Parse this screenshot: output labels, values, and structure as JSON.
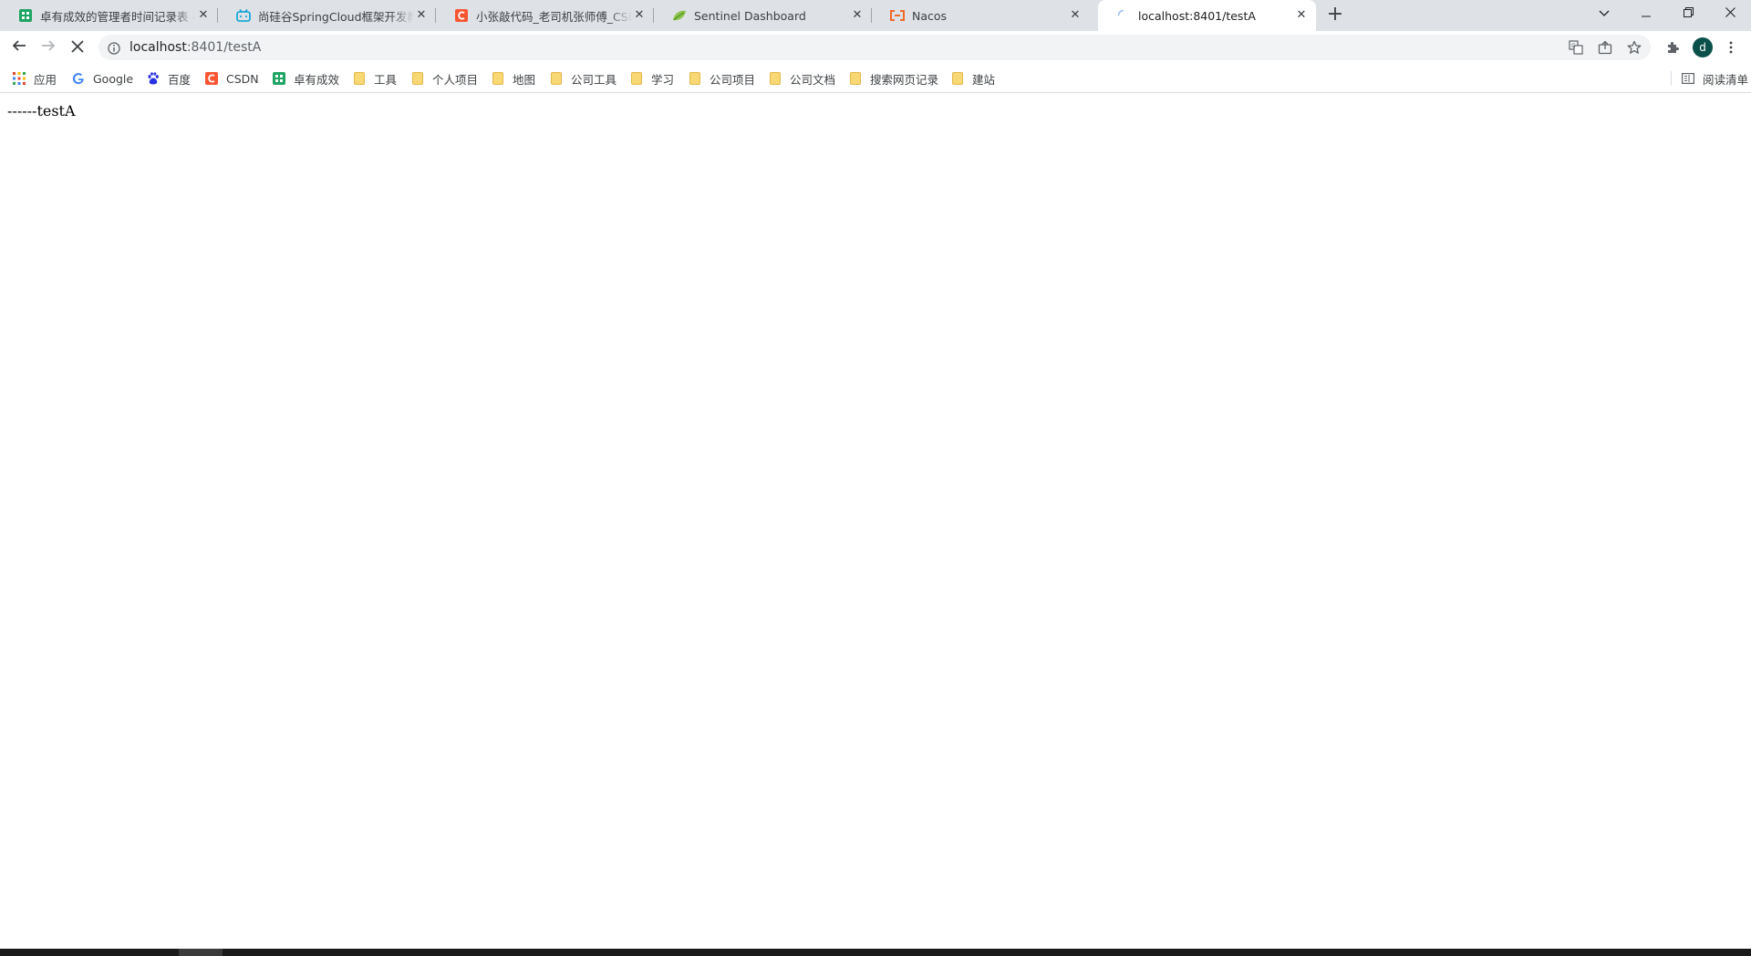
{
  "browser": {
    "tabs": [
      {
        "title": "卓有成效的管理者时间记录表 - 金山文档",
        "icon": "sheet-icon",
        "active": false
      },
      {
        "title": "尚硅谷SpringCloud框架开发教程",
        "icon": "bilibili-icon",
        "active": false
      },
      {
        "title": "小张敲代码_老司机张师傅_CSDN博客",
        "icon": "csdn-icon",
        "active": false
      },
      {
        "title": "Sentinel Dashboard",
        "icon": "leaf-icon",
        "active": false
      },
      {
        "title": "Nacos",
        "icon": "nacos-icon",
        "active": false
      },
      {
        "title": "localhost:8401/testA",
        "icon": "loading-icon",
        "active": true
      }
    ],
    "tab_close": "✕",
    "new_tab": "+",
    "address_bar": {
      "host": "localhost",
      "path": ":8401/testA"
    },
    "avatar_letter": "d"
  },
  "bookmarks": {
    "items": [
      {
        "label": "应用",
        "icon": "apps-grid-icon"
      },
      {
        "label": "Google",
        "icon": "google-icon"
      },
      {
        "label": "百度",
        "icon": "baidu-icon"
      },
      {
        "label": "CSDN",
        "icon": "csdn-icon"
      },
      {
        "label": "卓有成效",
        "icon": "sheet-icon"
      },
      {
        "label": "工具",
        "icon": "folder-icon"
      },
      {
        "label": "个人项目",
        "icon": "folder-icon"
      },
      {
        "label": "地图",
        "icon": "folder-icon"
      },
      {
        "label": "公司工具",
        "icon": "folder-icon"
      },
      {
        "label": "学习",
        "icon": "folder-icon"
      },
      {
        "label": "公司项目",
        "icon": "folder-icon"
      },
      {
        "label": "公司文档",
        "icon": "folder-icon"
      },
      {
        "label": "搜索网页记录",
        "icon": "folder-icon"
      },
      {
        "label": "建站",
        "icon": "folder-icon"
      }
    ],
    "reading_list": "阅读清单"
  },
  "page": {
    "text": "------testA"
  },
  "colors": {
    "tabstrip_bg": "#dee1e6",
    "accent_sheet": "#1fa463",
    "accent_csdn": "#fc5531",
    "accent_bilibili": "#00a1d6",
    "accent_nacos": "#f06a2a"
  }
}
